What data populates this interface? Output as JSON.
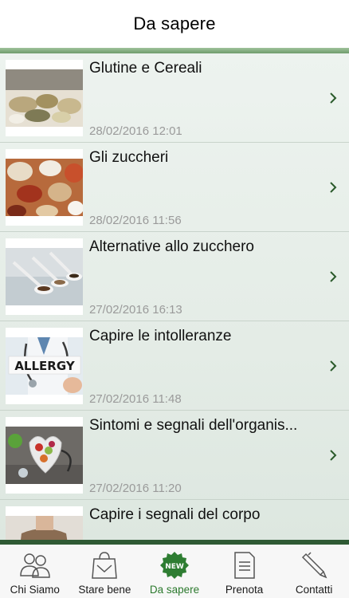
{
  "header": {
    "title": "Da sapere"
  },
  "articles": [
    {
      "title": "Glutine e Cereali",
      "date": "28/02/2016 12:01"
    },
    {
      "title": "Gli zuccheri",
      "date": "28/02/2016 11:56"
    },
    {
      "title": "Alternative allo zucchero",
      "date": "27/02/2016 16:13"
    },
    {
      "title": "Capire le intolleranze",
      "date": "27/02/2016 11:48"
    },
    {
      "title": "Sintomi e segnali dell'organis...",
      "date": "27/02/2016 11:20"
    },
    {
      "title": "Capire i segnali del corpo",
      "date": ""
    }
  ],
  "thumb_texts": {
    "allergy": "ALLERGY"
  },
  "tabs": [
    {
      "label": "Chi Siamo",
      "icon": "people-icon"
    },
    {
      "label": "Stare bene",
      "icon": "shopping-bag-icon"
    },
    {
      "label": "Da sapere",
      "icon": "new-badge-icon",
      "badge": "NEW",
      "active": true
    },
    {
      "label": "Prenota",
      "icon": "document-icon"
    },
    {
      "label": "Contatti",
      "icon": "pen-icon"
    }
  ],
  "colors": {
    "active_tab": "#2c7a2e",
    "header_stripe": "#7fa97c",
    "tabbar_stripe": "#2f5a34",
    "date_text": "#9a9a9a"
  }
}
